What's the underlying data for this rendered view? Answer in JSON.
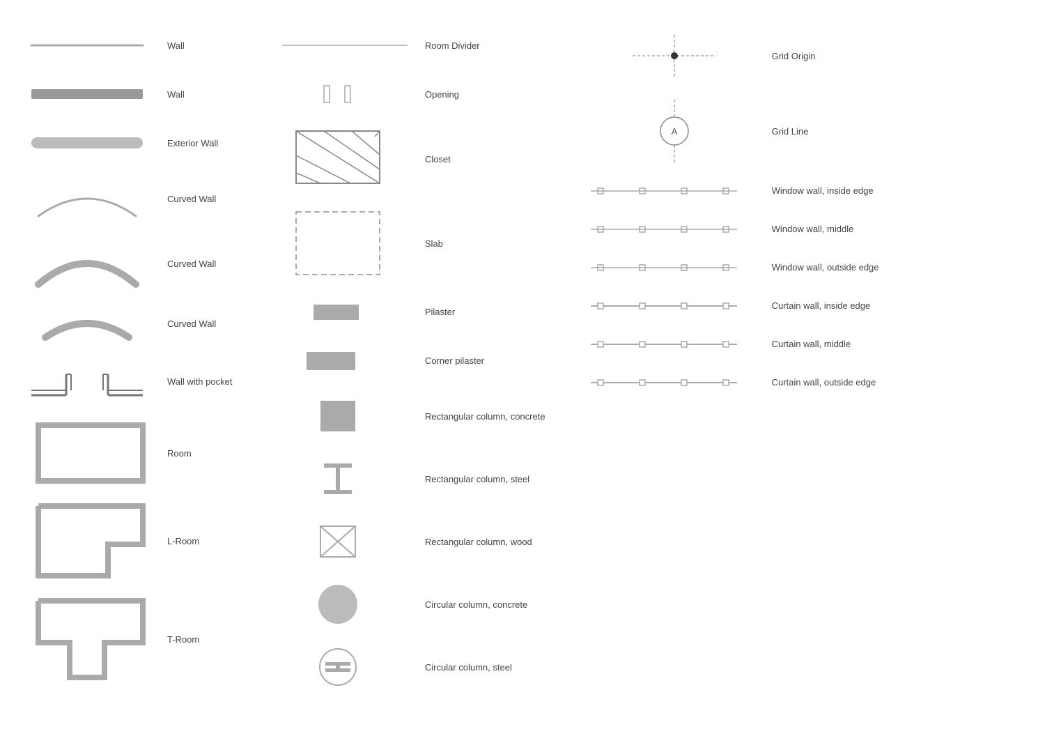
{
  "col1": {
    "items": [
      {
        "id": "wall1",
        "label": "Wall"
      },
      {
        "id": "wall2",
        "label": "Wall"
      },
      {
        "id": "exterior-wall",
        "label": "Exterior Wall"
      },
      {
        "id": "curved-wall1",
        "label": "Curved Wall"
      },
      {
        "id": "curved-wall2",
        "label": "Curved Wall"
      },
      {
        "id": "curved-wall3",
        "label": "Curved Wall"
      },
      {
        "id": "wall-pocket",
        "label": "Wall with pocket"
      },
      {
        "id": "room",
        "label": "Room"
      },
      {
        "id": "l-room",
        "label": "L-Room"
      },
      {
        "id": "t-room",
        "label": "T-Room"
      }
    ]
  },
  "col2": {
    "items": [
      {
        "id": "room-divider",
        "label": "Room Divider"
      },
      {
        "id": "opening",
        "label": "Opening"
      },
      {
        "id": "closet",
        "label": "Closet"
      },
      {
        "id": "slab",
        "label": "Slab"
      },
      {
        "id": "pilaster",
        "label": "Pilaster"
      },
      {
        "id": "corner-pilaster",
        "label": "Corner pilaster"
      },
      {
        "id": "rect-col-concrete",
        "label": "Rectangular column, concrete"
      },
      {
        "id": "rect-col-steel",
        "label": "Rectangular column, steel"
      },
      {
        "id": "rect-col-wood",
        "label": "Rectangular column, wood"
      },
      {
        "id": "circ-col-concrete",
        "label": "Circular column, concrete"
      },
      {
        "id": "circ-col-steel",
        "label": "Circular column, steel"
      }
    ]
  },
  "col3": {
    "items": [
      {
        "id": "grid-origin",
        "label": "Grid Origin"
      },
      {
        "id": "grid-line",
        "label": "Grid Line"
      },
      {
        "id": "ww-inside",
        "label": "Window wall, inside edge"
      },
      {
        "id": "ww-middle",
        "label": "Window wall, middle"
      },
      {
        "id": "ww-outside",
        "label": "Window wall, outside edge"
      },
      {
        "id": "cw-inside",
        "label": "Curtain wall, inside edge"
      },
      {
        "id": "cw-middle",
        "label": "Curtain wall, middle"
      },
      {
        "id": "cw-outside",
        "label": "Curtain wall, outside edge"
      }
    ]
  }
}
